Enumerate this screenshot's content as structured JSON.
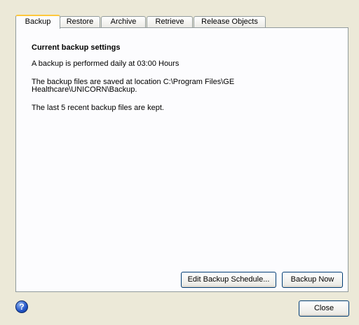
{
  "tabs": [
    {
      "label": "Backup",
      "active": true
    },
    {
      "label": "Restore",
      "active": false
    },
    {
      "label": "Archive",
      "active": false
    },
    {
      "label": "Retrieve",
      "active": false
    },
    {
      "label": "Release Objects",
      "active": false
    }
  ],
  "backup": {
    "heading": "Current backup settings",
    "schedule_text": "A backup is performed daily at 03:00 Hours",
    "location_line1": "The backup files are saved at location C:\\Program Files\\GE",
    "location_line2": "Healthcare\\UNICORN\\Backup.",
    "retention_text": "The last 5 recent backup files are kept."
  },
  "buttons": {
    "edit_schedule": "Edit Backup Schedule...",
    "backup_now": "Backup Now",
    "close": "Close"
  },
  "icons": {
    "help": "help-icon"
  },
  "colors": {
    "window_bg": "#ECE9D8",
    "panel_bg": "#FCFCFE",
    "active_tab_accent": "#FFC83C",
    "button_border": "#003C74"
  }
}
